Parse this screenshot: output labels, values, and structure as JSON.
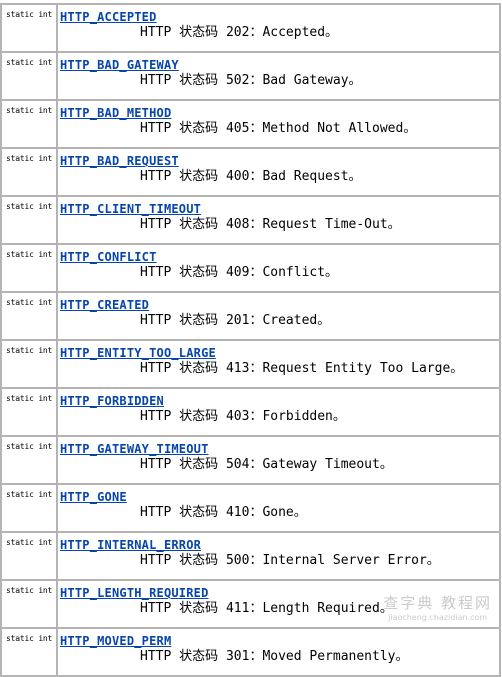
{
  "fields": [
    {
      "type": "static int",
      "name": "HTTP_ACCEPTED",
      "desc": "HTTP 状态码 202：Accepted。"
    },
    {
      "type": "static int",
      "name": "HTTP_BAD_GATEWAY",
      "desc": "HTTP 状态码 502：Bad Gateway。"
    },
    {
      "type": "static int",
      "name": "HTTP_BAD_METHOD",
      "desc": "HTTP 状态码 405：Method Not Allowed。"
    },
    {
      "type": "static int",
      "name": "HTTP_BAD_REQUEST",
      "desc": "HTTP 状态码 400：Bad Request。"
    },
    {
      "type": "static int",
      "name": "HTTP_CLIENT_TIMEOUT",
      "desc": "HTTP 状态码 408：Request Time-Out。"
    },
    {
      "type": "static int",
      "name": "HTTP_CONFLICT",
      "desc": "HTTP 状态码 409：Conflict。"
    },
    {
      "type": "static int",
      "name": "HTTP_CREATED",
      "desc": "HTTP 状态码 201：Created。"
    },
    {
      "type": "static int",
      "name": "HTTP_ENTITY_TOO_LARGE",
      "desc": "HTTP 状态码 413：Request Entity Too Large。"
    },
    {
      "type": "static int",
      "name": "HTTP_FORBIDDEN",
      "desc": "HTTP 状态码 403：Forbidden。"
    },
    {
      "type": "static int",
      "name": "HTTP_GATEWAY_TIMEOUT",
      "desc": "HTTP 状态码 504：Gateway Timeout。"
    },
    {
      "type": "static int",
      "name": "HTTP_GONE",
      "desc": "HTTP 状态码 410：Gone。"
    },
    {
      "type": "static int",
      "name": "HTTP_INTERNAL_ERROR",
      "desc": "HTTP 状态码 500：Internal Server Error。"
    },
    {
      "type": "static int",
      "name": "HTTP_LENGTH_REQUIRED",
      "desc": "HTTP 状态码 411：Length Required。"
    },
    {
      "type": "static int",
      "name": "HTTP_MOVED_PERM",
      "desc": "HTTP 状态码 301：Moved Permanently。"
    }
  ],
  "watermark": {
    "line1": "查字典 教程网",
    "line2": "jiaocheng.chazidian.com"
  },
  "colors": {
    "link": "#0645ad",
    "border": "#b4b4b4"
  }
}
